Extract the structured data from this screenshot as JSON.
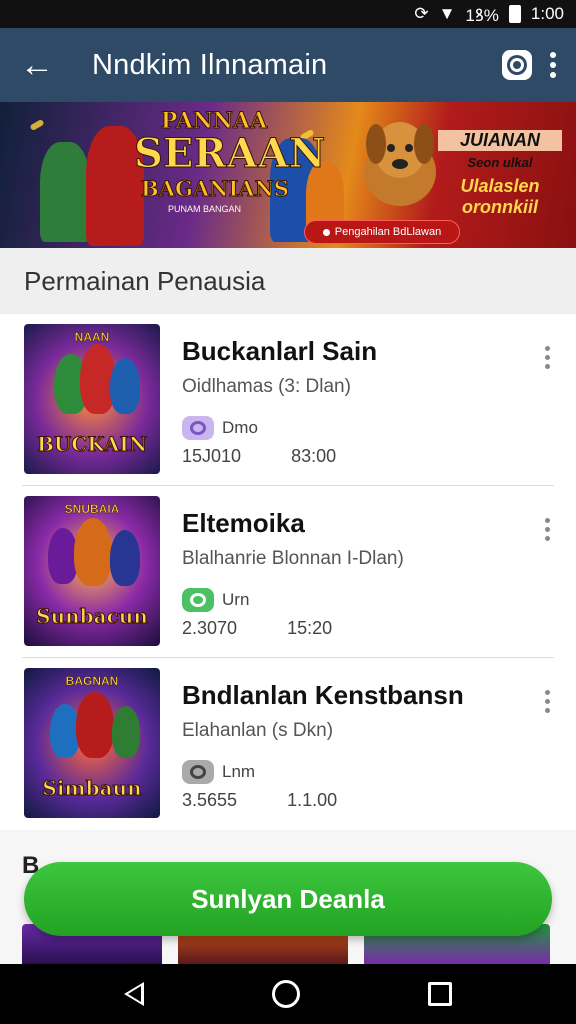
{
  "status_bar": {
    "time": "1:00",
    "battery_text": "1ꝸ%"
  },
  "app_bar": {
    "title": "Nndkim Ilnnamain"
  },
  "banner": {
    "title_line1": "PANNAA",
    "title_line2": "SERAAN",
    "title_line3": "BAGANIANS",
    "title_small": "PUNAM BANGAN",
    "promo_line1": "JUIANAN",
    "promo_line2": "Seon ulkal",
    "promo_line3": "Ulalaslen oronnkiil",
    "promo_button": "Pengahilan BdLlawan"
  },
  "section": {
    "title": "Permainan Penausia"
  },
  "games": [
    {
      "name": "Buckanlarl Sain",
      "subtitle": "Oidlhamas (3: Dlan)",
      "badge": "Dmo",
      "stat1": "15J010",
      "stat2": "83:00",
      "thumb_title": "BUCKAIN",
      "thumb_top": "NAAN",
      "badge_color": "#c9b6f0"
    },
    {
      "name": "Eltemoika",
      "subtitle": "Blalhanrie Blonnan I-Dlan)",
      "badge": "Urn",
      "stat1": "2.3070",
      "stat2": "15:20",
      "thumb_title": "Sunbacun",
      "thumb_top": "SNUBAIA",
      "badge_color": "#4cc163"
    },
    {
      "name": "Bndlanlan Kenstbansn",
      "subtitle": "Elahanlan (s Dkn)",
      "badge": "Lnm",
      "stat1": "3.5655",
      "stat2": "1.1.00",
      "thumb_title": "Simbaun",
      "thumb_top": "BAGNAN",
      "badge_color": "#aaaaaa"
    }
  ],
  "below": {
    "label": "B"
  },
  "cta": {
    "label": "Sunlyan Deanla"
  }
}
